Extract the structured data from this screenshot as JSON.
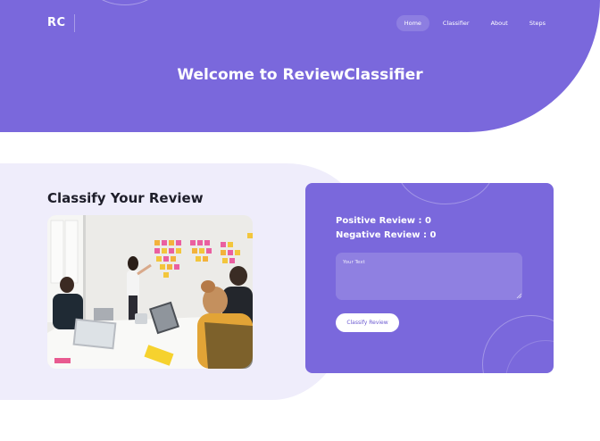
{
  "brand": {
    "logo": "RC"
  },
  "nav": {
    "items": [
      {
        "label": "Home",
        "active": true
      },
      {
        "label": "Classifier",
        "active": false
      },
      {
        "label": "About",
        "active": false
      },
      {
        "label": "Steps",
        "active": false
      }
    ]
  },
  "hero": {
    "title": "Welcome to ReviewClassifier"
  },
  "section": {
    "title": "Classify Your Review"
  },
  "photo": {
    "description_icon": "team-meeting-photo"
  },
  "classifier": {
    "positive_label": "Positive Review : 0",
    "negative_label": "Negative Review : 0",
    "input_placeholder": "Your Text",
    "input_value": "",
    "button_label": "Classify Review"
  },
  "colors": {
    "accent": "#7a68dc",
    "band": "#efedfb",
    "text_dark": "#1e1e2a",
    "white": "#ffffff"
  }
}
